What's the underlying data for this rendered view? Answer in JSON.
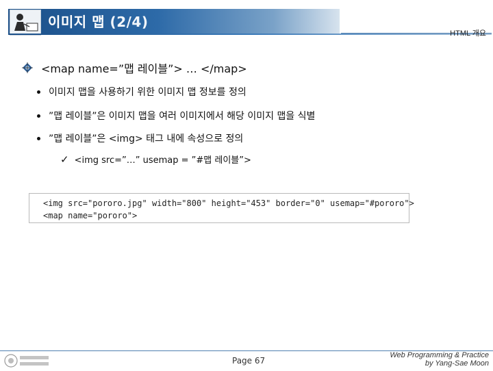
{
  "header": {
    "title": "이미지 맵",
    "title_part": "(2/4)",
    "section": "HTML 개요"
  },
  "main_bullet": {
    "text": "<map name=”맵 레이블”> … </map>"
  },
  "sub_bullets": [
    "이미지 맵을 사용하기 위한 이미지 맵 정보를 정의",
    "”맵 레이블”은 이미지 맵을 여러 이미지에서 해당 이미지 맵을 식별",
    "”맵 레이블”은 <img> 태그 내에 속성으로 정의"
  ],
  "check_item": {
    "mark": "✓",
    "text": "<img src=”…” usemap = ”#맵 레이블”>"
  },
  "code": {
    "lines": [
      "<img src=\"pororo.jpg\" width=\"800\" height=\"453\" border=\"0\" usemap=\"#pororo\">",
      "<map name=\"pororo\">"
    ]
  },
  "footer": {
    "page": "Page 67",
    "credit_line1": "Web Programming & Practice",
    "credit_line2": "by Yang-Sae Moon"
  },
  "colors": {
    "header_blue": "#1b4f88",
    "rule_blue": "#4f7fb0"
  }
}
